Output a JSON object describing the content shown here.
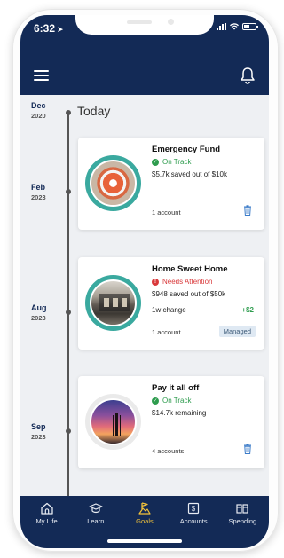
{
  "status_bar": {
    "time": "6:32",
    "time_arrow": "➤"
  },
  "header": {
    "menu_icon": "hamburger-icon",
    "notification_icon": "bell-icon"
  },
  "timeline": {
    "today_label": "Today",
    "dates": [
      {
        "month": "Dec",
        "year": "2020"
      },
      {
        "month": "Feb",
        "year": "2023"
      },
      {
        "month": "Aug",
        "year": "2023"
      },
      {
        "month": "Sep",
        "year": "2023"
      }
    ]
  },
  "goals": [
    {
      "title": "Emergency Fund",
      "status": "On Track",
      "status_type": "ok",
      "progress_text": "$5.7k saved out of $10k",
      "accounts": "1 account",
      "image": "lifebuoy"
    },
    {
      "title": "Home Sweet Home",
      "status": "Needs Attention",
      "status_type": "warn",
      "progress_text": "$948 saved out of $50k",
      "change_label": "1w change",
      "change_value": "+$2",
      "accounts": "1 account",
      "badge": "Managed",
      "image": "house"
    },
    {
      "title": "Pay it all off",
      "status": "On Track",
      "status_type": "ok",
      "progress_text": "$14.7k remaining",
      "accounts": "4 accounts",
      "image": "sunset"
    }
  ],
  "tabs": [
    {
      "label": "My Life",
      "icon": "home-icon",
      "active": false
    },
    {
      "label": "Learn",
      "icon": "graduation-cap-icon",
      "active": false
    },
    {
      "label": "Goals",
      "icon": "goals-flag-icon",
      "active": true
    },
    {
      "label": "Accounts",
      "icon": "dollar-account-icon",
      "active": false
    },
    {
      "label": "Spending",
      "icon": "spending-icon",
      "active": false
    }
  ],
  "colors": {
    "navy": "#132a56",
    "teal_ring": "#3aa99f",
    "active_tab": "#f1c13a",
    "on_track": "#2e9c4e",
    "needs_attention": "#d9393b"
  }
}
